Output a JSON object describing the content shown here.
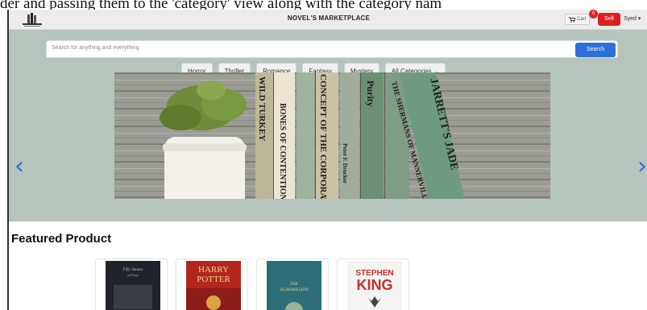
{
  "doc_text": "der and passing them to the 'category' view along with the category nam",
  "navbar": {
    "brand": "NOVEL'S MARKETPLACE",
    "logo_icon": "bookshelf-logo-icon",
    "cart_label": "Cart",
    "cart_count": "0",
    "sell_label": "Sell",
    "user_name": "Syed",
    "user_caret": "▾"
  },
  "search": {
    "placeholder": "Search for anything and everything",
    "button_label": "Search"
  },
  "categories": [
    {
      "label": "Horror"
    },
    {
      "label": "Thriller"
    },
    {
      "label": "Romance"
    },
    {
      "label": "Fantasy"
    },
    {
      "label": "Mystery"
    }
  ],
  "all_categories_label": "All Categories",
  "banner": {
    "spines": [
      "WILD TURKEY",
      "BONES OF CONTENTION",
      "CONCEPT OF THE CORPORATION",
      "Peter F. Drucker",
      "Purity",
      "THE SHERMANS OF MANNERVILLE",
      "JARRETT'S JADE"
    ],
    "arrow_left": "‹",
    "arrow_right": "›"
  },
  "featured": {
    "title": "Featured Product",
    "books": [
      {
        "line1": "Fifty Shades",
        "line2": "of Grey"
      },
      {
        "line1": "HARRY",
        "line2": "POTTER"
      },
      {
        "line1": "THE",
        "line2": "SILMARILLION"
      },
      {
        "line1": "STEPHEN",
        "line2": "KING"
      }
    ]
  },
  "colors": {
    "hero_bg": "#b5c4bd",
    "primary": "#2f6fdc",
    "sell": "#dc2020"
  }
}
